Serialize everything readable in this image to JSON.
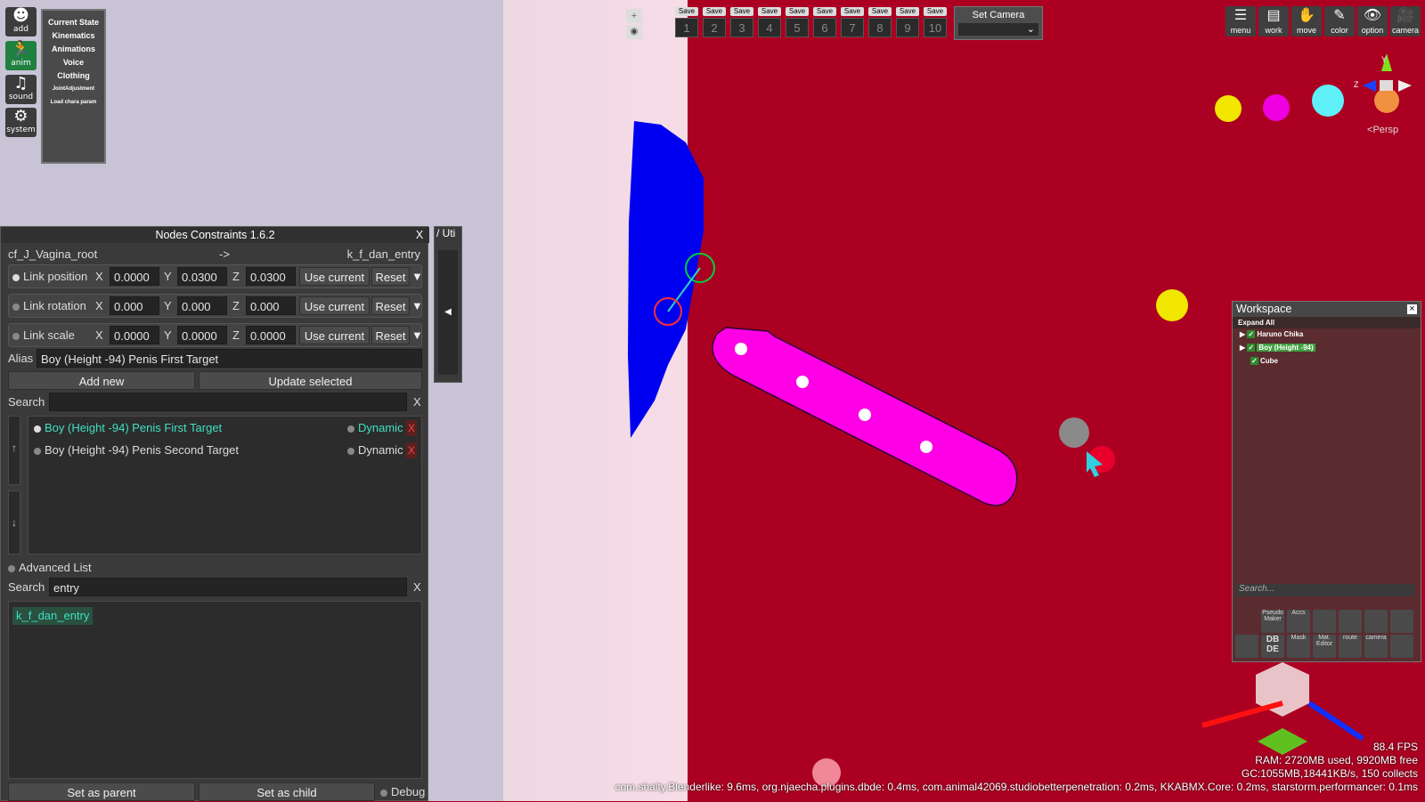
{
  "left_toolbar": {
    "buttons": [
      "add",
      "anim",
      "sound",
      "system"
    ],
    "state_menu": [
      "Current State",
      "Kinematics",
      "Animations",
      "Voice",
      "Clothing",
      "JointAdjustment",
      "Load chara param"
    ]
  },
  "save_bar": {
    "slots": [
      {
        "label": "Save",
        "num": "1"
      },
      {
        "label": "Save",
        "num": "2"
      },
      {
        "label": "Save",
        "num": "3"
      },
      {
        "label": "Save",
        "num": "4"
      },
      {
        "label": "Save",
        "num": "5"
      },
      {
        "label": "Save",
        "num": "6"
      },
      {
        "label": "Save",
        "num": "7"
      },
      {
        "label": "Save",
        "num": "8"
      },
      {
        "label": "Save",
        "num": "9"
      },
      {
        "label": "Save",
        "num": "10"
      }
    ],
    "set_camera": "Set Camera"
  },
  "top_right_icons": [
    "menu",
    "work",
    "move",
    "color",
    "option",
    "camera"
  ],
  "gizmo": {
    "label": "Persp",
    "axis_y": "Y",
    "axis_z": "Z"
  },
  "panel": {
    "title": "Nodes Constraints 1.6.2",
    "close": "X",
    "side_tab": "/ Uti",
    "parent_node": "cf_J_Vagina_root",
    "arrow": "->",
    "child_node": "k_f_dan_entry",
    "link_position": {
      "label": "Link position",
      "x": "0.0000",
      "y": "0.0300",
      "z": "0.0300"
    },
    "link_rotation": {
      "label": "Link rotation",
      "x": "0.000",
      "y": "0.000",
      "z": "0.000"
    },
    "link_scale": {
      "label": "Link scale",
      "x": "0.0000",
      "y": "0.0000",
      "z": "0.0000"
    },
    "axis_x": "X",
    "axis_y": "Y",
    "axis_z": "Z",
    "use_current": "Use current",
    "reset": "Reset",
    "dropdown": "▼",
    "alias_label": "Alias",
    "alias_value": "Boy (Height -94) Penis First Target",
    "add_new": "Add new",
    "update_selected": "Update selected",
    "search_label": "Search",
    "search_value": "",
    "clear": "X",
    "constraints": [
      {
        "name": "Boy (Height -94) Penis First Target",
        "dynamic": "Dynamic",
        "remove": "X"
      },
      {
        "name": "Boy (Height -94) Penis Second Target",
        "dynamic": "Dynamic",
        "remove": "X"
      }
    ],
    "up_arrow": "↑",
    "down_arrow": "↓",
    "advanced_list": "Advanced List",
    "search2_label": "Search",
    "search2_value": "entry",
    "results": [
      "k_f_dan_entry"
    ],
    "set_as_parent": "Set as parent",
    "set_as_child": "Set as child",
    "debug": "Debug",
    "collapse_arrow": "◀"
  },
  "workspace": {
    "title": "Workspace",
    "close": "×",
    "expand_all": "Expand All",
    "items": [
      "Haruno Chika",
      "Boy (Height -94)",
      "Cube"
    ],
    "search_placeholder": "Search...",
    "icons_row1": [
      "Pseudo Maker",
      "Accs",
      "",
      "",
      "",
      ""
    ],
    "icons_row2": [
      "",
      "DB DE",
      "Mask",
      "Mat. Editor",
      "route",
      "camera",
      ""
    ]
  },
  "stats": {
    "fps": "88.4 FPS",
    "ram": "RAM: 2720MB used, 9920MB free",
    "gc": "GC:1055MB,18441KB/s, 150 collects",
    "plugins": "com.shalty.Blenderlike: 9.6ms, org.njaecha.plugins.dbde: 0.4ms, com.animal42069.studiobetterpenetration: 0.2ms, KKABMX.Core: 0.2ms, starstorm.performancer: 0.1ms"
  },
  "colors": {
    "scene_red": "#ab0022",
    "penis_shape": "#ff00e6",
    "blue_shape": "#0000f0",
    "panel_bg": "#3a3a3a",
    "highlight_text": "#40e0c0"
  }
}
